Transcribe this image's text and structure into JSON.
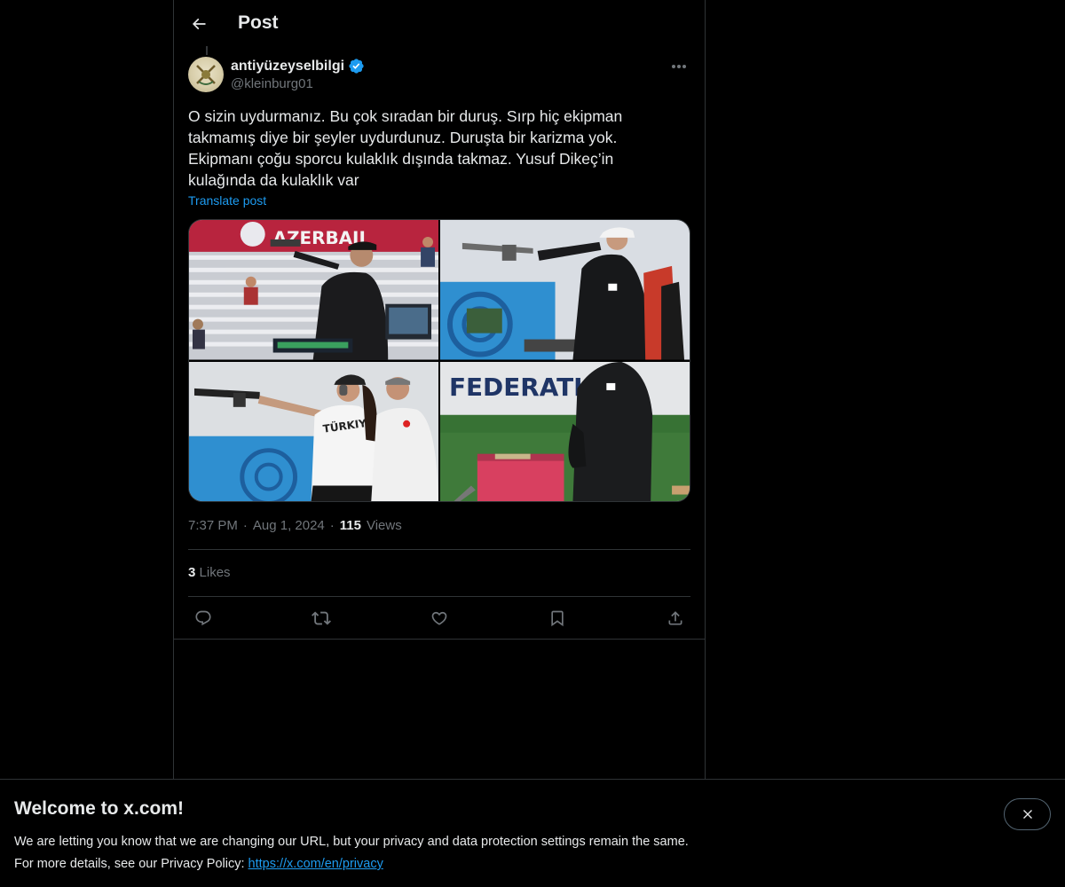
{
  "header": {
    "title": "Post",
    "back_icon": "arrow-left-icon"
  },
  "post": {
    "author_name": "antiyüzeyselbilgi",
    "author_handle": "@kleinburg01",
    "verified": true,
    "text": "O sizin uydurmanız. Bu çok sıradan bir duruş. Sırp hiç ekipman\ntakmamış diye bir şeyler uydurdunuz. Duruşta bir karizma yok.\nEkipmanı çoğu sporcu kulaklık dışında takmaz. Yusuf Dikeç’in\nkulağında da kulaklık var",
    "translate_label": "Translate post",
    "time": "7:37 PM",
    "date": "Aug 1, 2024",
    "views_count": "115",
    "views_label": "Views",
    "likes_count": "3",
    "likes_label": "Likes",
    "media": [
      {
        "name": "shooter-stadium-photo",
        "sign_text": "AZERBAIJ"
      },
      {
        "name": "shooter-white-cap-photo"
      },
      {
        "name": "turkish-shooters-photo",
        "shirt_text": "TÜRKIYE"
      },
      {
        "name": "shooter-hand-in-pocket-photo",
        "sign_text": "FEDERATION"
      }
    ]
  },
  "actions": [
    "reply-icon",
    "repost-icon",
    "like-icon",
    "bookmark-icon",
    "share-icon"
  ],
  "banner": {
    "title": "Welcome to x.com!",
    "line1": "We are letting you know that we are changing our URL, but your privacy and data protection settings remain the same.",
    "line2_prefix": "For more details, see our Privacy Policy: ",
    "link_text": "https://x.com/en/privacy"
  },
  "colors": {
    "accent": "#1d9bf0",
    "text": "#e7e9ea",
    "muted": "#71767b",
    "border": "#2f3336",
    "background": "#000000"
  }
}
